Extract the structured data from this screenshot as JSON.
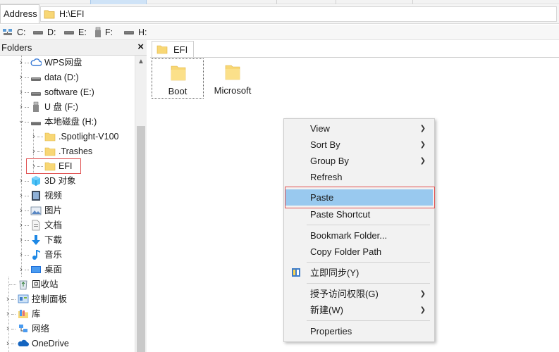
{
  "address": {
    "label": "Address",
    "path": "H:\\EFI"
  },
  "drives": [
    {
      "label": "C:",
      "icon": "network-drive-icon"
    },
    {
      "label": "D:",
      "icon": "hard-drive-icon"
    },
    {
      "label": "E:",
      "icon": "hard-drive-icon"
    },
    {
      "label": "F:",
      "icon": "usb-drive-icon"
    },
    {
      "label": "H:",
      "icon": "hard-drive-icon"
    }
  ],
  "folders_panel": {
    "title": "Folders",
    "close": "×",
    "items": [
      {
        "label": "WPS网盘",
        "icon": "cloud-icon"
      },
      {
        "label": "data (D:)",
        "icon": "hard-drive-icon"
      },
      {
        "label": "software (E:)",
        "icon": "hard-drive-icon"
      },
      {
        "label": "U 盘 (F:)",
        "icon": "usb-drive-icon"
      },
      {
        "label": "本地磁盘 (H:)",
        "icon": "hard-drive-icon"
      },
      {
        "label": ".Spotlight-V100",
        "icon": "folder-icon"
      },
      {
        "label": ".Trashes",
        "icon": "folder-icon"
      },
      {
        "label": "EFI",
        "icon": "folder-icon"
      },
      {
        "label": "3D 对象",
        "icon": "3d-objects-icon"
      },
      {
        "label": "视频",
        "icon": "videos-icon"
      },
      {
        "label": "图片",
        "icon": "pictures-icon"
      },
      {
        "label": "文档",
        "icon": "documents-icon"
      },
      {
        "label": "下载",
        "icon": "downloads-icon"
      },
      {
        "label": "音乐",
        "icon": "music-icon"
      },
      {
        "label": "桌面",
        "icon": "desktop-icon"
      },
      {
        "label": "回收站",
        "icon": "recycle-bin-icon"
      },
      {
        "label": "控制面板",
        "icon": "control-panel-icon"
      },
      {
        "label": "库",
        "icon": "libraries-icon"
      },
      {
        "label": "网络",
        "icon": "network-icon"
      },
      {
        "label": "OneDrive",
        "icon": "onedrive-icon"
      }
    ]
  },
  "content": {
    "tab_label": "EFI",
    "files": [
      {
        "name": "Boot",
        "icon": "folder-icon"
      },
      {
        "name": "Microsoft",
        "icon": "folder-icon"
      }
    ]
  },
  "context_menu": {
    "items": [
      {
        "label": "View",
        "has_submenu": true
      },
      {
        "label": "Sort By",
        "has_submenu": true
      },
      {
        "label": "Group By",
        "has_submenu": true
      },
      {
        "label": "Refresh",
        "has_submenu": false
      },
      {
        "label": "Paste",
        "has_submenu": false
      },
      {
        "label": "Paste Shortcut",
        "has_submenu": false
      },
      {
        "label": "Bookmark Folder...",
        "has_submenu": false
      },
      {
        "label": "Copy Folder Path",
        "has_submenu": false
      },
      {
        "label": "立即同步(Y)",
        "has_submenu": false,
        "icon": "sync-icon"
      },
      {
        "label": "授予访问权限(G)",
        "has_submenu": true
      },
      {
        "label": "新建(W)",
        "has_submenu": true
      },
      {
        "label": "Properties",
        "has_submenu": false
      }
    ],
    "highlighted": "Paste"
  },
  "colors": {
    "hover": "#99c9ef",
    "annotation": "#e05050",
    "folder": "#f8d775"
  }
}
